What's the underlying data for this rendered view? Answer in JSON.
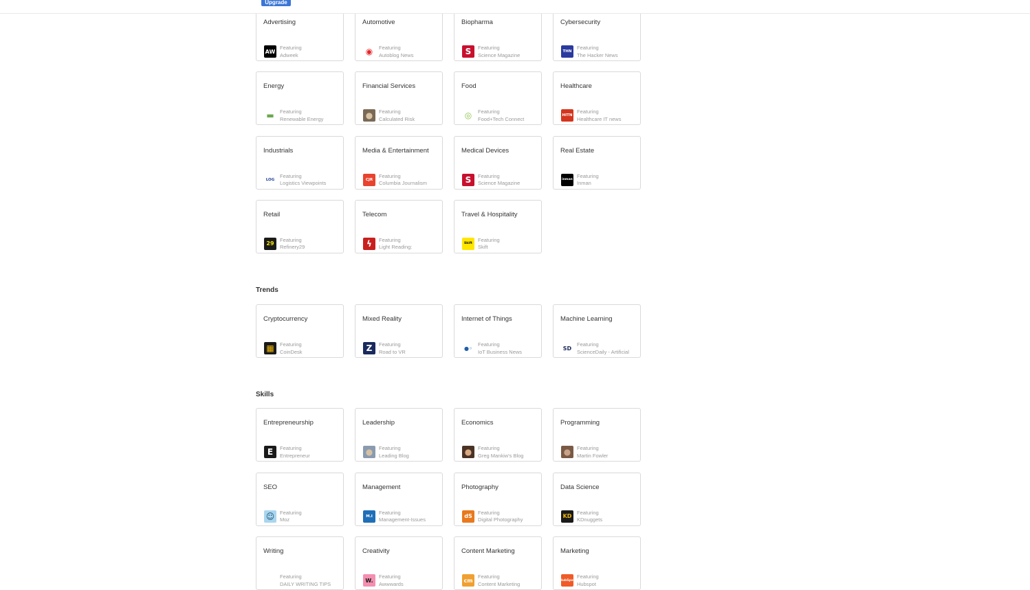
{
  "header": {
    "upgrade_label": "Upgrade"
  },
  "featuring_label": "Featuring",
  "industries": [
    {
      "title": "Advertising",
      "source": "Adweek",
      "icon": "adweek-logo-icon",
      "icon_text": "AW",
      "icon_bg": "#000000",
      "icon_fg": "#ffffff"
    },
    {
      "title": "Automotive",
      "source": "Autoblog News",
      "icon": "autoblog-logo-icon",
      "icon_text": "◉",
      "icon_bg": "#ffffff",
      "icon_fg": "#e3262b"
    },
    {
      "title": "Biopharma",
      "source": "Science Magazine",
      "icon": "science-magazine-logo-icon",
      "icon_text": "S",
      "icon_bg": "#c8102e",
      "icon_fg": "#ffffff"
    },
    {
      "title": "Cybersecurity",
      "source": "The Hacker News",
      "icon": "hacker-news-logo-icon",
      "icon_text": "THN",
      "icon_bg": "#2b3a9e",
      "icon_fg": "#ffffff"
    },
    {
      "title": "Energy",
      "source": "Renewable Energy",
      "icon": "renewable-energy-logo-icon",
      "icon_text": "▬",
      "icon_bg": "#ffffff",
      "icon_fg": "#6aa84f"
    },
    {
      "title": "Financial Services",
      "source": "Calculated Risk",
      "icon": "calculated-risk-avatar-icon",
      "icon_text": "●",
      "icon_bg": "#7a6a55",
      "icon_fg": "#d9c3a5"
    },
    {
      "title": "Food",
      "source": "Food+Tech Connect",
      "icon": "food-tech-connect-logo-icon",
      "icon_text": "◎",
      "icon_bg": "#ffffff",
      "icon_fg": "#8bc34a"
    },
    {
      "title": "Healthcare",
      "source": "Healthcare IT news",
      "icon": "healthcare-it-news-logo-icon",
      "icon_text": "HITN",
      "icon_bg": "#d4351c",
      "icon_fg": "#ffffff"
    },
    {
      "title": "Industrials",
      "source": "Logistics Viewpoints",
      "icon": "logistics-viewpoints-logo-icon",
      "icon_text": "LOG",
      "icon_bg": "#ffffff",
      "icon_fg": "#1c3f94"
    },
    {
      "title": "Media & Entertainment",
      "source": "Columbia Journalism",
      "icon": "cjr-logo-icon",
      "icon_text": "CJR",
      "icon_bg": "#e8432e",
      "icon_fg": "#ffffff"
    },
    {
      "title": "Medical Devices",
      "source": "Science Magazine",
      "icon": "science-magazine-logo-icon",
      "icon_text": "S",
      "icon_bg": "#c8102e",
      "icon_fg": "#ffffff"
    },
    {
      "title": "Real Estate",
      "source": "Inman",
      "icon": "inman-logo-icon",
      "icon_text": "inman",
      "icon_bg": "#000000",
      "icon_fg": "#ffffff"
    },
    {
      "title": "Retail",
      "source": "Refinery29",
      "icon": "refinery29-logo-icon",
      "icon_text": "29",
      "icon_bg": "#1a1a1a",
      "icon_fg": "#f5e600"
    },
    {
      "title": "Telecom",
      "source": "Light Reading:",
      "icon": "light-reading-logo-icon",
      "icon_text": "ϟ",
      "icon_bg": "#c8201e",
      "icon_fg": "#ffffff"
    },
    {
      "title": "Travel & Hospitality",
      "source": "Skift",
      "icon": "skift-logo-icon",
      "icon_text": "Skift",
      "icon_bg": "#ffe600",
      "icon_fg": "#000000"
    }
  ],
  "trends": {
    "title": "Trends",
    "cards": [
      {
        "title": "Cryptocurrency",
        "source": "CoinDesk",
        "icon": "coindesk-logo-icon",
        "icon_text": "▦",
        "icon_bg": "#1a1a1a",
        "icon_fg": "#f2b705"
      },
      {
        "title": "Mixed Reality",
        "source": "Road to VR",
        "icon": "road-to-vr-logo-icon",
        "icon_text": "Z",
        "icon_bg": "#1a2a5e",
        "icon_fg": "#ffffff"
      },
      {
        "title": "Internet of Things",
        "source": "IoT Business News",
        "icon": "iot-business-news-logo-icon",
        "icon_text": "●◦",
        "icon_bg": "#ffffff",
        "icon_fg": "#1f5fa8"
      },
      {
        "title": "Machine Learning",
        "source": "ScienceDaily - Artificial",
        "icon": "sciencedaily-logo-icon",
        "icon_text": "SD",
        "icon_bg": "#ffffff",
        "icon_fg": "#1c2a5a"
      }
    ]
  },
  "skills": {
    "title": "Skills",
    "cards": [
      {
        "title": "Entrepreneurship",
        "source": "Entrepreneur",
        "icon": "entrepreneur-logo-icon",
        "icon_text": "E",
        "icon_bg": "#1a1a1a",
        "icon_fg": "#ffffff"
      },
      {
        "title": "Leadership",
        "source": "Leading Blog",
        "icon": "leading-blog-avatar-icon",
        "icon_text": "●",
        "icon_bg": "#8a9bb0",
        "icon_fg": "#d6c1a5"
      },
      {
        "title": "Economics",
        "source": "Greg Mankiw's Blog",
        "icon": "greg-mankiw-avatar-icon",
        "icon_text": "●",
        "icon_bg": "#4a3326",
        "icon_fg": "#d9a982"
      },
      {
        "title": "Programming",
        "source": "Martin Fowler",
        "icon": "martin-fowler-avatar-icon",
        "icon_text": "●",
        "icon_bg": "#7a5a45",
        "icon_fg": "#c9a389"
      },
      {
        "title": "SEO",
        "source": "Moz",
        "icon": "moz-logo-icon",
        "icon_text": "☺",
        "icon_bg": "#a9d6ef",
        "icon_fg": "#1b4f72"
      },
      {
        "title": "Management",
        "source": "Management-Issues",
        "icon": "management-issues-logo-icon",
        "icon_text": "M.I",
        "icon_bg": "#1f6fb8",
        "icon_fg": "#ffffff"
      },
      {
        "title": "Photography",
        "source": "Digital Photography",
        "icon": "digital-photography-logo-icon",
        "icon_text": "dS",
        "icon_bg": "#e8791e",
        "icon_fg": "#ffffff"
      },
      {
        "title": "Data Science",
        "source": "KDnuggets",
        "icon": "kdnuggets-logo-icon",
        "icon_text": "KD",
        "icon_bg": "#1a1a1a",
        "icon_fg": "#f2b705"
      },
      {
        "title": "Writing",
        "source": "DAILY WRITING TIPS",
        "icon": "daily-writing-tips-logo-icon",
        "icon_text": "",
        "icon_bg": "#ffffff",
        "icon_fg": "#999999"
      },
      {
        "title": "Creativity",
        "source": "Awwwards",
        "icon": "awwwards-logo-icon",
        "icon_text": "W.",
        "icon_bg": "#f48fb1",
        "icon_fg": "#1a1a1a"
      },
      {
        "title": "Content Marketing",
        "source": "Content Marketing",
        "icon": "content-marketing-logo-icon",
        "icon_text": "cm",
        "icon_bg": "#f0a030",
        "icon_fg": "#ffffff"
      },
      {
        "title": "Marketing",
        "source": "Hubspot",
        "icon": "hubspot-logo-icon",
        "icon_text": "HubSpot",
        "icon_bg": "#f05a28",
        "icon_fg": "#ffffff"
      }
    ]
  }
}
